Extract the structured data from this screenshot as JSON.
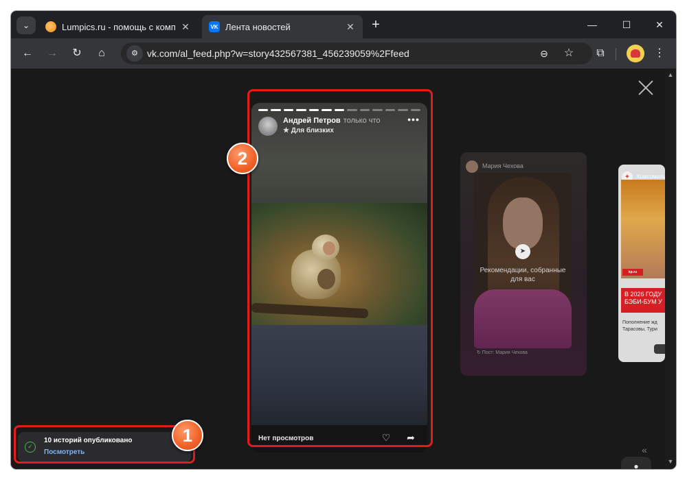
{
  "browser": {
    "tabs": [
      {
        "title": "Lumpics.ru - помощь с компью",
        "favicon": "lumpics-favicon",
        "active": false
      },
      {
        "title": "Лента новостей",
        "favicon": "vk-favicon",
        "active": true
      }
    ],
    "tab_close_glyph": "✕",
    "new_tab_glyph": "+",
    "tab_search_glyph": "⌄",
    "window_controls": {
      "minimize": "—",
      "maximize": "☐",
      "close": "✕"
    },
    "nav": {
      "back": "←",
      "forward": "→",
      "reload": "↻",
      "home": "⌂"
    },
    "url": "vk.com/al_feed.php?w=story432567381_456239059%2Ffeed",
    "toolbar_icons": {
      "zoom": "⊖",
      "bookmark": "☆",
      "extensions": "⧉",
      "menu": "⋮",
      "site_info": "⚙"
    }
  },
  "viewer": {
    "close_icon": "close-icon",
    "story": {
      "author": "Андрей Петров",
      "time": "только что",
      "audience": "★ Для близких",
      "more": "•••",
      "progress": {
        "total": 13,
        "completed": 7
      },
      "views": "Нет просмотров",
      "react_glyph": "♡",
      "share_glyph": "➦"
    },
    "side_story": {
      "author": "Мария Чехова",
      "recommendation": "Рекомендации, собранные для вас",
      "rec_glyph": "➤",
      "post_caption": "↻ Пост: Мария Чехова"
    },
    "far_story": {
      "author": "Комсомольская",
      "avatar_glyph": "✦",
      "badge": "kp.ru",
      "headline_line1": "В 2026 ГОДУ",
      "headline_line2": "БЭБИ-БУМ У",
      "text_line1": "Пополнение жд",
      "text_line2": "Тарасовы, Тури"
    },
    "collapse_glyph": "«",
    "chat_glyph": "●"
  },
  "toast": {
    "icon_glyph": "✓",
    "title": "10 историй опубликовано",
    "link": "Посмотреть"
  },
  "callouts": {
    "one": "1",
    "two": "2"
  },
  "colors": {
    "highlight": "#e21b1b",
    "callout": "#f06127",
    "vk_blue": "#0077ff",
    "success": "#4bb34b"
  }
}
